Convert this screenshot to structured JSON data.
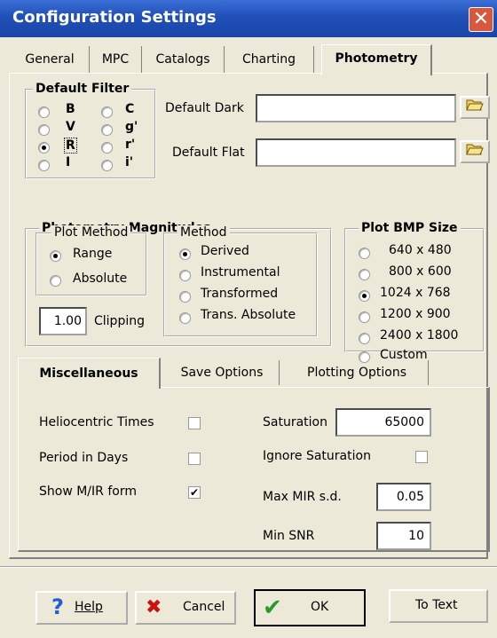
{
  "window": {
    "title": "Configuration Settings",
    "close_glyph": "✕"
  },
  "tabs": [
    {
      "label": "General"
    },
    {
      "label": "MPC"
    },
    {
      "label": "Catalogs"
    },
    {
      "label": "Charting"
    },
    {
      "label": "Photometry",
      "active": true
    }
  ],
  "default_filter": {
    "title": "Default Filter",
    "options": [
      {
        "label": "B",
        "selected": false
      },
      {
        "label": "C",
        "selected": false
      },
      {
        "label": "V",
        "selected": false
      },
      {
        "label": "g'",
        "selected": false
      },
      {
        "label": "R",
        "selected": true
      },
      {
        "label": "r'",
        "selected": false
      },
      {
        "label": "I",
        "selected": false
      },
      {
        "label": "i'",
        "selected": false
      }
    ]
  },
  "default_dark": {
    "label": "Default Dark",
    "value": ""
  },
  "default_flat": {
    "label": "Default Flat",
    "value": ""
  },
  "photometry_magnitudes": {
    "title": "Photometry Magnitudes",
    "plot_method": {
      "title": "Plot Method",
      "options": [
        {
          "label": "Range",
          "selected": true
        },
        {
          "label": "Absolute",
          "selected": false
        }
      ]
    },
    "method": {
      "title": "Method",
      "options": [
        {
          "label": "Derived",
          "selected": true
        },
        {
          "label": "Instrumental",
          "selected": false
        },
        {
          "label": "Transformed",
          "selected": false
        },
        {
          "label": "Trans. Absolute",
          "selected": false
        }
      ]
    },
    "clipping": {
      "value": "1.00",
      "label": "Clipping"
    }
  },
  "plot_bmp_size": {
    "title": "Plot BMP Size",
    "options": [
      {
        "label": "640 x  480",
        "selected": false
      },
      {
        "label": "800 x  600",
        "selected": false
      },
      {
        "label": "1024 x  768",
        "selected": true
      },
      {
        "label": "1200 x  900",
        "selected": false
      },
      {
        "label": "2400 x 1800",
        "selected": false
      },
      {
        "label": "Custom",
        "selected": false
      }
    ]
  },
  "sub_tabs": [
    {
      "label": "Miscellaneous",
      "active": true
    },
    {
      "label": "Save Options"
    },
    {
      "label": "Plotting Options"
    }
  ],
  "misc": {
    "heliocentric_times": {
      "label": "Heliocentric Times",
      "checked": false
    },
    "period_in_days": {
      "label": "Period in Days",
      "checked": false
    },
    "show_mir_form": {
      "label": "Show M/IR form",
      "checked": true
    },
    "saturation": {
      "label": "Saturation",
      "value": "65000"
    },
    "ignore_saturation": {
      "label": "Ignore Saturation",
      "checked": false
    },
    "max_mir_sd": {
      "label": "Max MIR s.d.",
      "value": "0.05"
    },
    "min_snr": {
      "label": "Min SNR",
      "value": "10"
    }
  },
  "buttons": {
    "help": "Help",
    "cancel": "Cancel",
    "ok": "OK",
    "to_text": "To Text"
  },
  "colors": {
    "titlebar": "#1f4fb8",
    "dialog_bg": "#ece9d8",
    "help_icon": "#1f5fd0",
    "cancel_icon": "#cc1111",
    "ok_icon": "#2a9a2a"
  }
}
